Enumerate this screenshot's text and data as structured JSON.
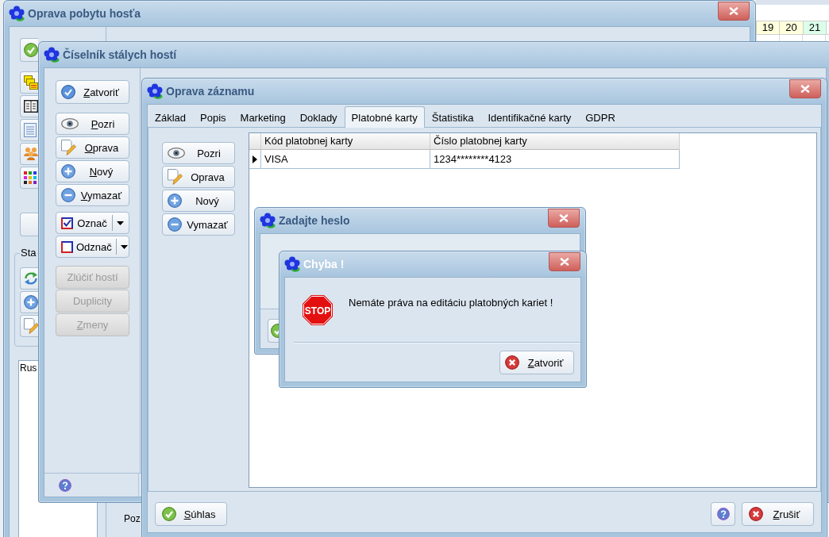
{
  "calendar": {
    "days": [
      {
        "label": "19",
        "color": "#ffffdc"
      },
      {
        "label": "20",
        "color": "#ffffdc"
      },
      {
        "label": "21",
        "color": "#dcffea"
      }
    ]
  },
  "stay_window": {
    "title": "Oprava pobytu hosťa",
    "active": false,
    "group_label": "Sta",
    "list_item": "Rus",
    "field_label": "Poz"
  },
  "guests_window": {
    "title": "Číselník stálych hostí",
    "active": false,
    "button_groups": [
      [
        {
          "label": "Zatvoriť",
          "kind": "close",
          "mnemonic": true,
          "disabled": false
        }
      ],
      [
        {
          "label": "Pozri",
          "kind": "view",
          "mnemonic": true,
          "disabled": false
        },
        {
          "label": "Oprava",
          "kind": "edit",
          "mnemonic": true,
          "disabled": false
        },
        {
          "label": "Nový",
          "kind": "new",
          "mnemonic": true,
          "disabled": false
        },
        {
          "label": "Vymazať",
          "kind": "delete",
          "mnemonic": true,
          "disabled": false
        }
      ],
      [
        {
          "label": "Označ",
          "kind": "mark",
          "checked": true,
          "mnemonic": false,
          "disabled": false
        },
        {
          "label": "Odznač",
          "kind": "mark",
          "checked": false,
          "mnemonic": false,
          "disabled": false
        }
      ],
      [
        {
          "label": "Zlúčiť hostí",
          "kind": "plain",
          "mnemonic": false,
          "disabled": true
        },
        {
          "label": "Duplicity",
          "kind": "plain",
          "mnemonic": false,
          "disabled": true
        },
        {
          "label": "Zmeny",
          "kind": "plain",
          "mnemonic": true,
          "disabled": true
        }
      ]
    ]
  },
  "record_window": {
    "title": "Oprava záznamu",
    "active": false,
    "tabs": [
      {
        "label": "Základ",
        "selected": false
      },
      {
        "label": "Popis",
        "selected": false
      },
      {
        "label": "Marketing",
        "selected": false
      },
      {
        "label": "Doklady",
        "selected": false
      },
      {
        "label": "Platobné karty",
        "selected": true
      },
      {
        "label": "Štatistika",
        "selected": false
      },
      {
        "label": "Identifikačné karty",
        "selected": false
      },
      {
        "label": "GDPR",
        "selected": false
      }
    ],
    "side_buttons": [
      {
        "label": "Pozri",
        "kind": "view",
        "mnemonic": false,
        "disabled": false
      },
      {
        "label": "Oprava",
        "kind": "edit",
        "mnemonic": false,
        "disabled": false
      },
      {
        "label": "Nový",
        "kind": "new",
        "mnemonic": false,
        "disabled": false
      },
      {
        "label": "Vymazať",
        "kind": "delete",
        "mnemonic": false,
        "disabled": false
      }
    ],
    "table": {
      "columns": [
        "Kód platobnej karty",
        "Číslo platobnej karty"
      ],
      "rows": [
        {
          "selected": true,
          "cells": [
            "VISA",
            "1234********4123"
          ]
        }
      ]
    },
    "footer_buttons": [
      {
        "label": "Súhlas",
        "kind": "accept",
        "mnemonic": true,
        "disabled": false
      },
      {
        "kind": "help",
        "disabled": false
      },
      {
        "label": "Zrušiť",
        "kind": "dismiss",
        "mnemonic": true,
        "disabled": false
      }
    ]
  },
  "password_dialog": {
    "title": "Zadajte heslo",
    "active": false,
    "buttons": [
      {
        "kind": "accept",
        "disabled": false
      }
    ]
  },
  "error_dialog": {
    "title": "Chyba !",
    "active": true,
    "icon_label": "STOP",
    "message": "Nemáte práva na editáciu platobných kariet !",
    "button": {
      "label": "Zatvoriť",
      "kind": "dismiss",
      "mnemonic": true,
      "disabled": false
    }
  }
}
